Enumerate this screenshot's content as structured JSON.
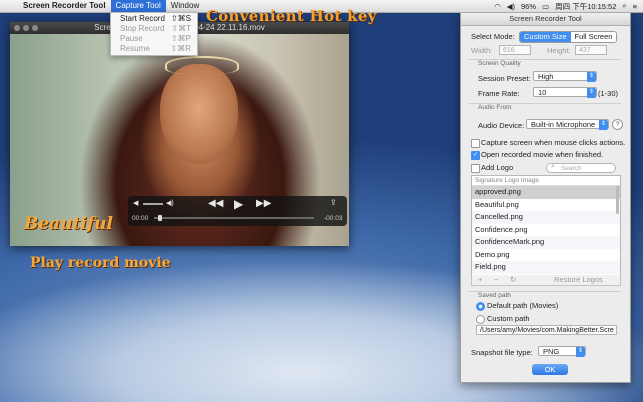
{
  "menubar": {
    "app_name": "Screen Recorder Tool",
    "menus": [
      "Capture Tool",
      "Window"
    ],
    "status": {
      "battery": "96%",
      "clock": "周四 下午10:15:52"
    }
  },
  "capture_menu": {
    "items": [
      {
        "label": "Start Record",
        "shortcut": "⇧⌘S",
        "enabled": true
      },
      {
        "label": "Stop Record",
        "shortcut": "⇧⌘T",
        "enabled": false
      },
      {
        "label": "Pause",
        "shortcut": "⇧⌘P",
        "enabled": false
      },
      {
        "label": "Resume",
        "shortcut": "⇧⌘R",
        "enabled": false
      }
    ]
  },
  "captions": {
    "hotkey": "Convenient  Hot key",
    "play": "Play record movie"
  },
  "video_window": {
    "title": "Screen Recorder Tool 2014-04-24 22.11.16.mov",
    "logo_text": "Beautiful",
    "time_elapsed": "00:00",
    "time_remaining": "-00:03"
  },
  "panel": {
    "title": "Screen Recorder Tool",
    "select_mode_label": "Select Mode:",
    "modes": [
      "Custom Size",
      "Full Screen"
    ],
    "active_mode": "Custom Size",
    "width_label": "Width:",
    "width_placeholder": "616",
    "height_label": "Height:",
    "height_placeholder": "437",
    "screen_quality_title": "Screen  Quality",
    "session_preset_label": "Session Preset:",
    "session_preset_value": "High",
    "frame_rate_label": "Frame Rate:",
    "frame_rate_value": "10",
    "frame_rate_range": "(1-30)",
    "audio_from_title": "Audio From",
    "audio_device_label": "Audio Device:",
    "audio_device_value": "Built-in Microphone",
    "capture_mouse_label": "Capture screen when mouse clicks actions.",
    "capture_mouse_checked": false,
    "open_movie_label": "Open recorded movie when finished.",
    "open_movie_checked": true,
    "add_logo_label": "Add Logo",
    "add_logo_checked": false,
    "search_placeholder": "Search",
    "logo_list_header": "Signature Logo Image",
    "logo_items": [
      "approved.png",
      "Beautiful.png",
      "Cancelled.png",
      "Confidence.png",
      "ConfidenceMark.png",
      "Demo.png",
      "Field.png"
    ],
    "selected_logo": "approved.png",
    "list_add": "+",
    "list_remove": "−",
    "list_refresh": "↻",
    "restore_logos_label": "Restore Logos",
    "saved_path_title": "Saved path",
    "default_path_label": "Default path (Movies)",
    "custom_path_label": "Custom path",
    "custom_path_value": "/Users/amy/Movies/com.MakingBetter.Scre",
    "snapshot_label": "Snapshot file type:",
    "snapshot_value": "PNG",
    "ok_label": "OK"
  },
  "icons": {
    "apple": "apple-icon",
    "wifi": "wifi-icon",
    "volume": "volume-icon",
    "battery": "battery-icon",
    "search": "search-icon",
    "list": "list-icon"
  }
}
